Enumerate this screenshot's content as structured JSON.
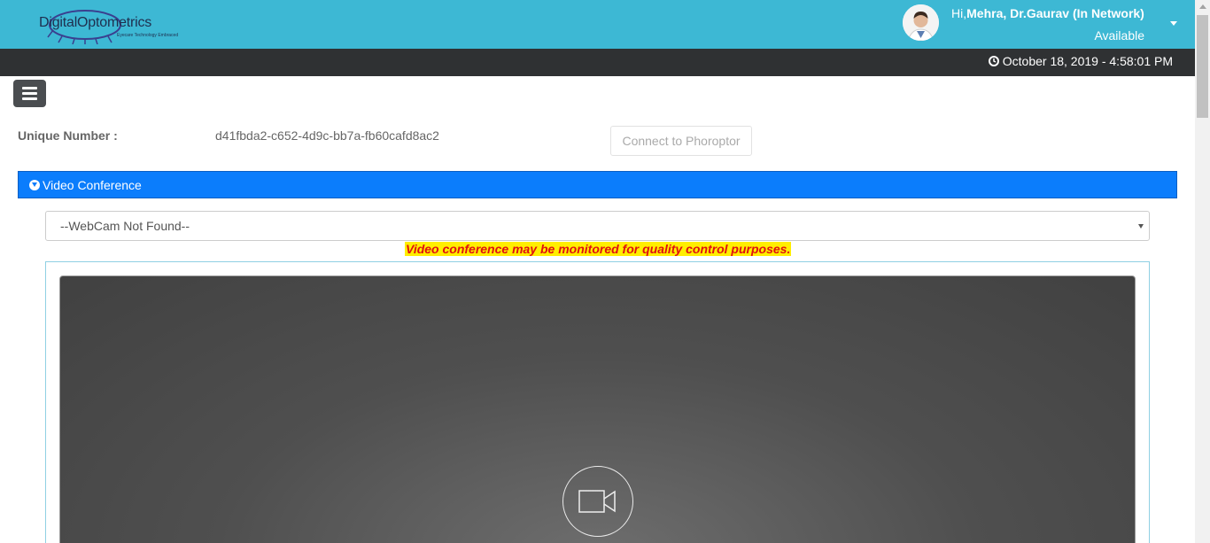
{
  "brand": {
    "name": "DigitalOptometrics",
    "tagline": "Eyecare Technology Embraced"
  },
  "user": {
    "greeting": "Hi,",
    "name": "Mehra, Dr.Gaurav (In Network)",
    "status": "Available"
  },
  "datetime": "October 18, 2019 - 4:58:01 PM",
  "unique": {
    "label": "Unique Number :",
    "value": "d41fbda2-c652-4d9c-bb7a-fb60cafd8ac2"
  },
  "connect_button": "Connect to Phoroptor",
  "video_section": {
    "title": "Video Conference",
    "camera_selected": "--WebCam Not Found--",
    "notice": "Video conference may be monitored for quality control purposes."
  },
  "colors": {
    "header": "#3db8d4",
    "datebar": "#2f3133",
    "section": "#0b7dfc",
    "notice_bg": "#ffee00",
    "notice_text": "#e01010"
  }
}
